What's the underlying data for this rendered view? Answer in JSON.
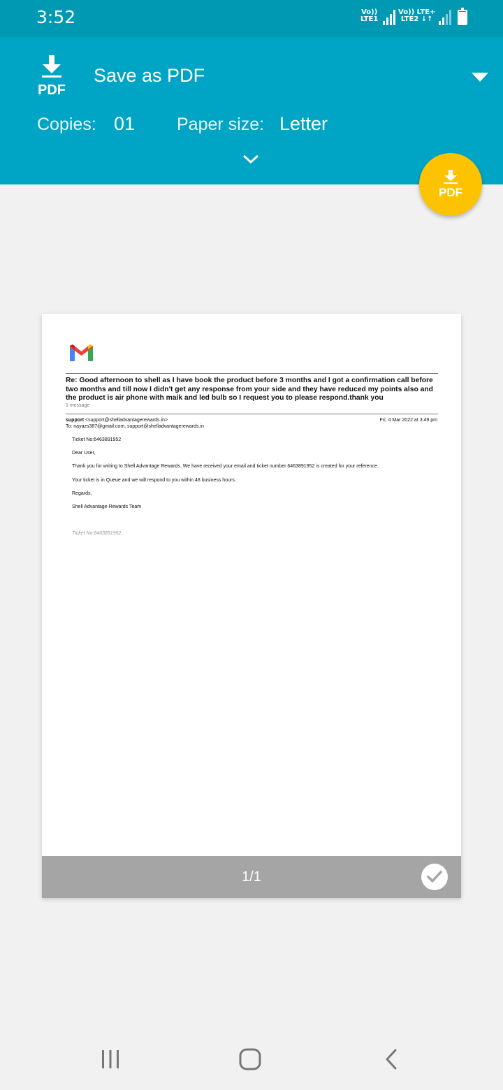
{
  "status_bar": {
    "time": "3:52",
    "sim1": {
      "top": "Vo))",
      "bottom": "LTE1"
    },
    "sim2": {
      "top": "Vo)) LTE+",
      "bottom": "LTE2 ↓↑"
    },
    "battery_level": 0.95
  },
  "header": {
    "logo_text": "PDF",
    "printer": "Save as PDF",
    "copies_label": "Copies:",
    "copies_value": "01",
    "paper_size_label": "Paper size:",
    "paper_size_value": "Letter"
  },
  "fab": {
    "label": "PDF",
    "color": "#fdc300"
  },
  "preview": {
    "subject": "Re: Good afternoon to shell as I have book the product before 3 months and I got a confirmation call before two months and till now I didn't get any response from your side and they have reduced my points also and the product is air phone with maik and led bulb so I request you to please respond.thank you",
    "message_count": "1 message",
    "sender_name": "support",
    "sender_email": "<support@shelladvantagerewards.in>",
    "date": "Fri, 4 Mar 2022 at 3:49 pm",
    "recipients": "To: nayazs387@gmail.com, support@shelladvantagerewards.in",
    "ticket_line": "Ticket No:6463891952",
    "greeting": "Dear User,",
    "body1": "Thank you for writing to Shell Advantage Rewards. We have received your email and ticket number 6463891952 is created for your reference.",
    "body2": "Your ticket is in Queue and we will respond to you within 48 business hours.",
    "regards": "Regards,",
    "signature": "Shell Advantage Rewards Team",
    "footer_ticket": "Ticket No:6463891952",
    "page_indicator": "1/1"
  },
  "colors": {
    "status_bar": "#0099b4",
    "header": "#00a5c5",
    "background": "#f1f1f1",
    "page_bar": "#a5a5a5"
  }
}
